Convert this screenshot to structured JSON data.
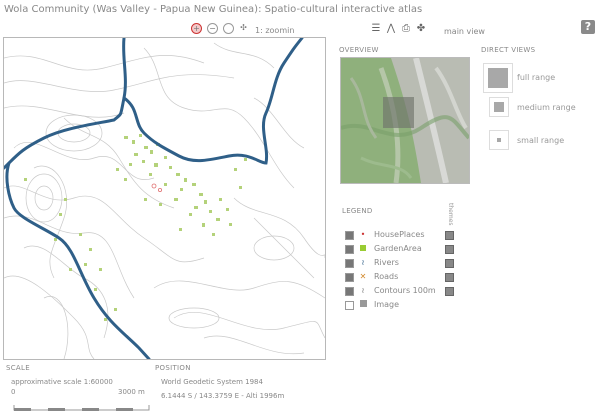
{
  "app": {
    "title": "Wola Community (Was Valley - Papua New Guinea): Spatio-cultural interactive atlas",
    "help": "?"
  },
  "toolbar": {
    "zoom_label": "1: zoomin",
    "main_view": "main view"
  },
  "overview": {
    "label": "OVERVIEW"
  },
  "direct_views": {
    "label": "DIRECT VIEWS",
    "items": [
      {
        "label": "full range"
      },
      {
        "label": "medium range"
      },
      {
        "label": "small range"
      }
    ]
  },
  "legend": {
    "label": "LEGEND",
    "themes_label": "themes",
    "items": [
      {
        "label": "HousePlaces",
        "color": "#cc3333"
      },
      {
        "label": "GardenArea",
        "color": "#99cc33"
      },
      {
        "label": "Rivers",
        "color": "#2f5f88"
      },
      {
        "label": "Roads",
        "color": "#d28a2e"
      },
      {
        "label": "Contours 100m",
        "color": "#777777"
      },
      {
        "label": "Image",
        "color": "#999999"
      }
    ]
  },
  "scale": {
    "label": "SCALE",
    "text": "approximative scale 1:60000",
    "tick_start": "0",
    "tick_end": "3000 m"
  },
  "position": {
    "label": "POSITION",
    "system": "World Geodetic System 1984",
    "coords": "6.1444 S / 143.3759 E - Alti 1996m"
  },
  "colors": {
    "river": "#2f5f88",
    "contour": "#bdbdbd",
    "garden": "#b4d27a"
  }
}
